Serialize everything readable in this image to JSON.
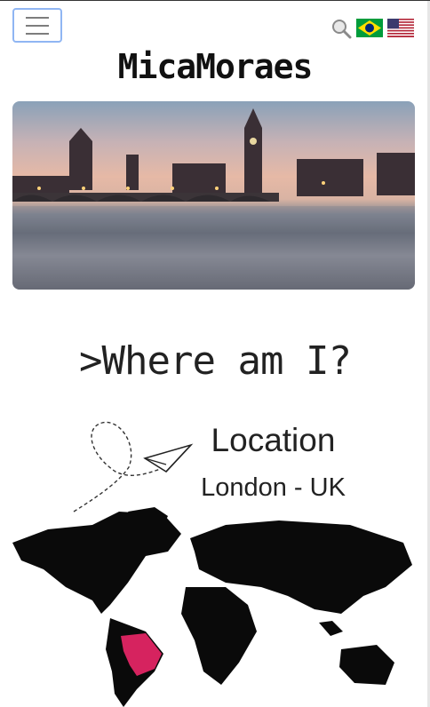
{
  "header": {
    "menu_button": "menu",
    "search_icon": "search-icon",
    "flags": [
      {
        "name": "brazil-flag-icon",
        "colors": [
          "#009c3b",
          "#ffdf00",
          "#002776"
        ]
      },
      {
        "name": "usa-flag-icon",
        "colors": [
          "#b22234",
          "#ffffff",
          "#3c3b6e"
        ]
      }
    ]
  },
  "brand": {
    "name": "MicaMoraes"
  },
  "hero": {
    "icon": "london-skyline-photo"
  },
  "section": {
    "title": ">Where am I?"
  },
  "location": {
    "label": "Location",
    "value": "London - UK"
  },
  "map": {
    "icon": "world-map-icon",
    "highlight_country": "Brazil",
    "highlight_color": "#d6235f"
  }
}
